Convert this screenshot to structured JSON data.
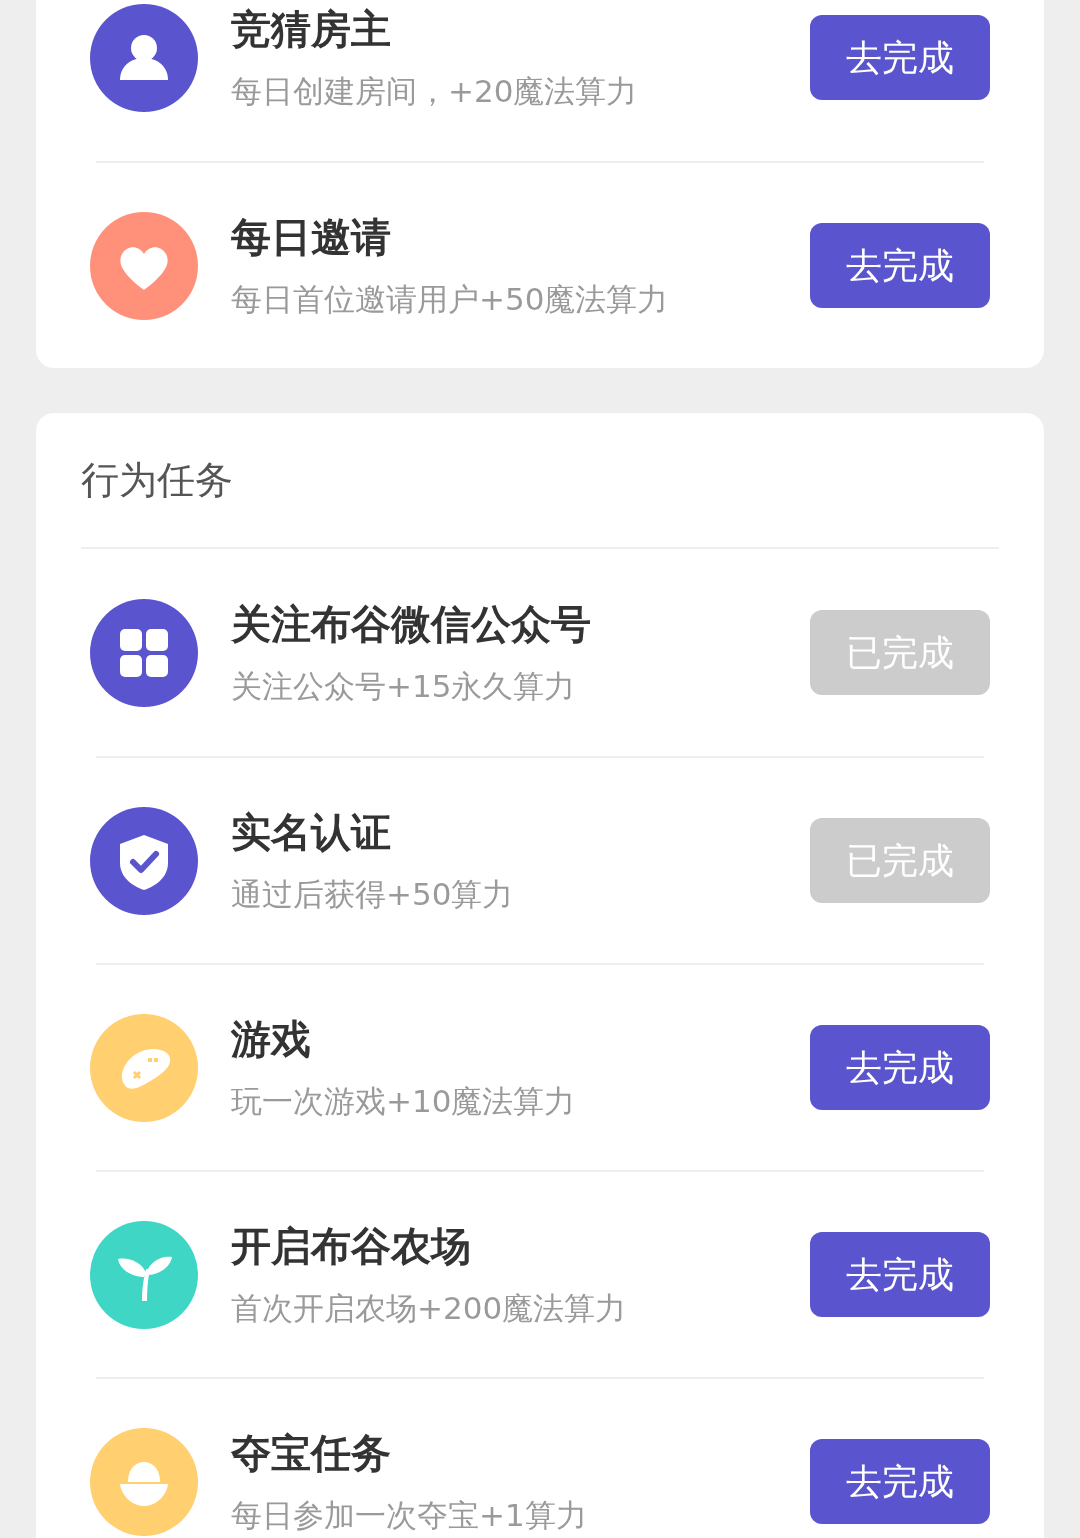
{
  "daily_tasks": [
    {
      "kind": "person",
      "color": "#5a55cf",
      "title": "竞猜房主",
      "subtitle": "每日创建房间，+20魔法算力",
      "button": "去完成",
      "done": false
    },
    {
      "kind": "heart",
      "color": "#ff907a",
      "title": "每日邀请",
      "subtitle": "每日首位邀请用户+50魔法算力",
      "button": "去完成",
      "done": false
    }
  ],
  "behavior_tasks": {
    "heading": "行为任务",
    "items": [
      {
        "kind": "grid",
        "color": "#5a55cf",
        "title": "关注布谷微信公众号",
        "subtitle": "关注公众号+15永久算力",
        "button": "已完成",
        "done": true
      },
      {
        "kind": "shield",
        "color": "#5a55cf",
        "title": "实名认证",
        "subtitle": "通过后获得+50算力",
        "button": "已完成",
        "done": true
      },
      {
        "kind": "gamepad",
        "color": "#ffcf70",
        "title": "游戏",
        "subtitle": "玩一次游戏+10魔法算力",
        "button": "去完成",
        "done": false
      },
      {
        "kind": "sprout",
        "color": "#3fd6c6",
        "title": "开启布谷农场",
        "subtitle": "首次开启农场+200魔法算力",
        "button": "去完成",
        "done": false
      },
      {
        "kind": "ingot",
        "color": "#ffcf70",
        "title": "夺宝任务",
        "subtitle": "每日参加一次夺宝+1算力",
        "button": "去完成",
        "done": false
      }
    ]
  }
}
